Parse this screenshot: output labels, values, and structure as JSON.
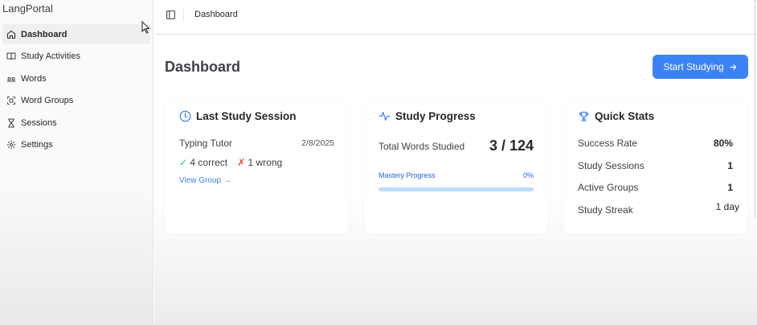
{
  "sidebar": {
    "brand": "LangPortal",
    "items": [
      {
        "label": "Dashboard",
        "icon": "home-icon"
      },
      {
        "label": "Study Activities",
        "icon": "book-open-icon"
      },
      {
        "label": "Words",
        "icon": "whole-word-icon"
      },
      {
        "label": "Word Groups",
        "icon": "group-icon"
      },
      {
        "label": "Sessions",
        "icon": "hourglass-icon"
      },
      {
        "label": "Settings",
        "icon": "gear-icon"
      }
    ]
  },
  "header": {
    "breadcrumb": "Dashboard"
  },
  "main": {
    "title": "Dashboard",
    "start_button": "Start Studying"
  },
  "last_session": {
    "title": "Last Study Session",
    "activity": "Typing Tutor",
    "date": "2/8/2025",
    "correct": "4 correct",
    "wrong": "1 wrong",
    "link": "View Group"
  },
  "study_progress": {
    "title": "Study Progress",
    "label": "Total Words Studied",
    "value": "3 / 124",
    "mastery_label": "Mastery Progress",
    "mastery_pct": "0%",
    "mastery_fraction": 0
  },
  "quick_stats": {
    "title": "Quick Stats",
    "rows": [
      {
        "label": "Success Rate",
        "value": "80%"
      },
      {
        "label": "Study Sessions",
        "value": "1"
      },
      {
        "label": "Active Groups",
        "value": "1"
      },
      {
        "label": "Study Streak",
        "value": "1 day"
      }
    ]
  },
  "colors": {
    "accent": "#3b82f6",
    "correct": "#22c55e",
    "wrong": "#ef4444"
  }
}
